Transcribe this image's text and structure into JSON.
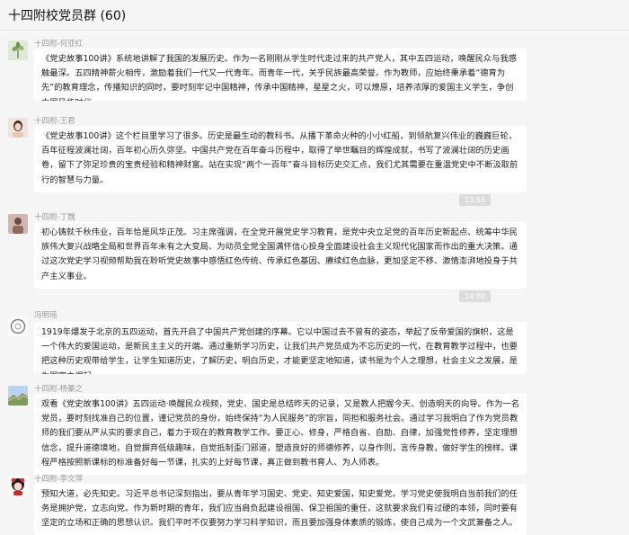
{
  "window": {
    "title": "十四附校党员群 (60)"
  },
  "timestamps": [
    "13:55",
    "14:00"
  ],
  "messages": [
    {
      "sender": "十四附-何亚红",
      "avatar_icon": "plant-photo-avatar",
      "text": "《党史故事100讲》系统地讲解了我国的发展历史。作为一名刚刚从学生时代走过来的共产党人，其中五四运动，唤醒民众与我感触最深。五四精神薪火相传，激励着我们一代又一代青年。而青年一代，关乎民族最高荣誉。作为教师，应始终秉承着“德育为先”的教育理念，传播知识的同时，要时刻牢记中国精神，传承中国精神，星星之火，可以燎原，培养浓厚的爱国主义学生，争创中国风华时代。"
    },
    {
      "sender": "十四附-王君",
      "avatar_icon": "woman-photo-avatar",
      "text": "《党史故事100讲》这个栏目里学习了很多。历史是最生动的教科书。从播下革命火种的小小红船，到领航复兴伟业的巍巍巨轮，百年征程波澜壮阔，百年初心历久弥坚。中国共产党在百年奋斗历程中，取得了举世瞩目的辉煌成就，书写了波澜壮阔的历史画卷，留下了弥足珍贵的宝贵经验和精神财富。站在实现“两个一百年”奋斗目标历史交汇点，我们尤其需要在重温党史中不断汲取前行的智慧与力量。"
    },
    {
      "sender": "十四附-丁魏",
      "avatar_icon": "person-photo-avatar",
      "text": "初心铸就千秋伟业，百年恰是风华正茂。习主席强调，在全党开展党史学习教育，是党中央立足党的百年历史新起点、统筹中华民族伟大复兴战略全局和世界百年未有之大变局、为动员全党全国满怀信心投身全面建设社会主义现代化国家而作出的重大决策。通过这次党史学习视频帮助我在聆听党史故事中感悟红色传统、传承红色基因、赓续红色血脉，更加坚定不移、激情澎湃地投身于共产主义事业。"
    },
    {
      "sender": "冯明瑶",
      "avatar_icon": "circle-logo-avatar",
      "text": "1919年爆发于北京的五四运动，首先开启了中国共产党创建的序幕。它以中国过去不曾有的姿态，举起了反帝爱国的旗帜，这是一个伟大的爱国运动，是新民主主义的开端。通过重新学习历史，让我们共产党员成为不忘历史的一代，在教育教学过程中，也要把这种历史观带给学生，让学生知道历史，了解历史，明白历史，才能更坚定地知道，读书是为个人之理想，社会主义之发展，是为国家之崛起。"
    },
    {
      "sender": "十四附-杨蓁之",
      "avatar_icon": "greatwall-photo-avatar",
      "text": "观看《党史故事100讲》五四运动·唤醒民众视频，党史、国史是总结昨天的记录，又是教人把握今天、创造明天的向导。作为一名党员，要时刻找准自己的位置，谨记党员的身份，始终保持“为人民服务”的宗旨，同担和服务社会。通过学习我明白了作为党员教师的我们要从严从实的要求自己，着力于现在的教育教学工作。要正心、修身，严格自省、自励、自律，加强党性修养，坚定理想信念，提升道德境地，自觉摒弃低级趣味，自觉抵制歪门邪道，塑造良好的师德修养，以身作则，言传身教，做好学生的榜样。课程严格按照新课标的标准备好每一节课，扎实的上好每节课，真正做到教书育人、为人师表。"
    },
    {
      "sender": "十四附-李文萍",
      "avatar_icon": "cartoon-avatar",
      "text": "预知大道，必先知史。习近平总书记深刻指出，要从青年学习国史、党史、知史爱国，知史爱党。学习党史使我明白当前我们的任务是拥护党，立志向党。作为新时期的青年，我们应当肩负起建设祖国、保卫祖国的重任，这就要求我们有过硬的本领，同时要有坚定的立场和正确的思想认识。我们平时不仅要努力学习科学知识，而且要加强身体素质的锻炼，使自己成为一个文武兼备之人。"
    }
  ]
}
